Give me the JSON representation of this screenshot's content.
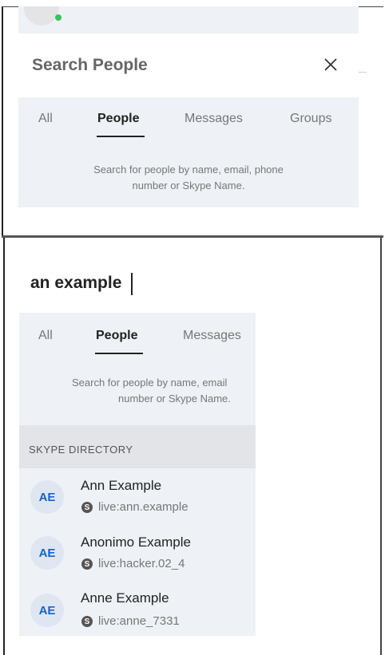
{
  "top": {
    "title": "Search People",
    "tabs": [
      "All",
      "People",
      "Messages",
      "Groups"
    ],
    "hint_line1": "Search for people by name, email, phone",
    "hint_line2": "number or Skype Name."
  },
  "bottom": {
    "search_value": "an example",
    "tabs": [
      "All",
      "People",
      "Messages"
    ],
    "hint_line1": "Search for people by name, email",
    "hint_line2": "number or Skype Name.",
    "directory_label": "SKYPE DIRECTORY",
    "contacts": [
      {
        "initials": "AE",
        "name": "Ann Example",
        "id": "live:ann.example"
      },
      {
        "initials": "AE",
        "name": "Anonimo Example",
        "id": "live:hacker.02_4"
      },
      {
        "initials": "AE",
        "name": "Anne Example",
        "id": "live:anne_7331"
      }
    ],
    "skype_badge": "S"
  },
  "colors": {
    "panel_bg": "#eef1f6",
    "directory_bg": "#e2e4e8",
    "avatar_bg": "#dfe6f2",
    "avatar_text": "#1a63c8",
    "online": "#35c35a"
  },
  "icons": {
    "close": "close-icon",
    "skype": "skype-icon",
    "online": "online-status-icon"
  }
}
